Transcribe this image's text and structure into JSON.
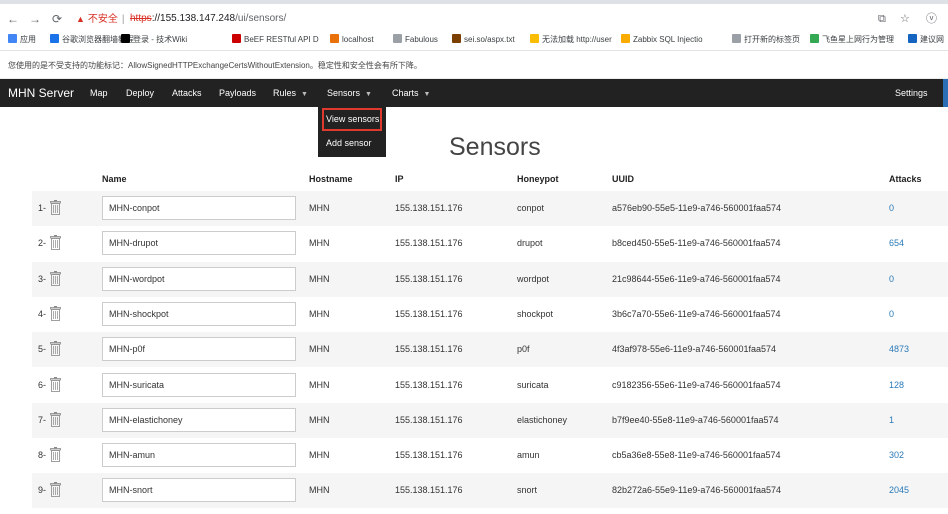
{
  "browser": {
    "security_label": "不安全",
    "url_protocol": "https",
    "url_host": "://155.138.147.248",
    "url_path": "/ui/sensors/",
    "bookmarks": [
      {
        "label": "应用",
        "color": "#4285f4"
      },
      {
        "label": "谷歌浏览器翻墙教程",
        "color": "#1a73e8"
      },
      {
        "label": "登录 - 技术Wiki",
        "color": "#000000"
      },
      {
        "label": "BeEF RESTful API D",
        "color": "#cc0000"
      },
      {
        "label": "localhost",
        "color": "#e8710a"
      },
      {
        "label": "Fabulous",
        "color": "#9aa0a6"
      },
      {
        "label": "sei.so/aspx.txt",
        "color": "#7b3f00"
      },
      {
        "label": "无法加载 http://user",
        "color": "#fbbc04"
      },
      {
        "label": "Zabbix SQL Injectio",
        "color": "#f9ab00"
      },
      {
        "label": "打开新的标签页",
        "color": "#9aa0a6"
      },
      {
        "label": "飞鱼星上网行为管理",
        "color": "#34a853"
      },
      {
        "label": "建议网",
        "color": "#1565c0"
      }
    ],
    "info_message": "您使用的是不受支持的功能标记：AllowSignedHTTPExchangeCertsWithoutExtension。稳定性和安全性会有所下降。"
  },
  "navbar": {
    "brand": "MHN Server",
    "items": [
      {
        "label": "Map",
        "dropdown": false
      },
      {
        "label": "Deploy",
        "dropdown": false
      },
      {
        "label": "Attacks",
        "dropdown": false
      },
      {
        "label": "Payloads",
        "dropdown": false
      },
      {
        "label": "Rules",
        "dropdown": true
      },
      {
        "label": "Sensors",
        "dropdown": true
      },
      {
        "label": "Charts",
        "dropdown": true
      }
    ],
    "settings": "Settings"
  },
  "sensors_menu": {
    "view": "View sensors",
    "add": "Add sensor"
  },
  "page_title": "Sensors",
  "table": {
    "headers": [
      "Name",
      "Hostname",
      "IP",
      "Honeypot",
      "UUID",
      "Attacks"
    ],
    "rows": [
      {
        "idx": "1-",
        "name": "MHN-conpot",
        "hostname": "MHN",
        "ip": "155.138.151.176",
        "honeypot": "conpot",
        "uuid": "a576eb90-55e5-11e9-a746-560001faa574",
        "attacks": "0"
      },
      {
        "idx": "2-",
        "name": "MHN-drupot",
        "hostname": "MHN",
        "ip": "155.138.151.176",
        "honeypot": "drupot",
        "uuid": "b8ced450-55e5-11e9-a746-560001faa574",
        "attacks": "654"
      },
      {
        "idx": "3-",
        "name": "MHN-wordpot",
        "hostname": "MHN",
        "ip": "155.138.151.176",
        "honeypot": "wordpot",
        "uuid": "21c98644-55e6-11e9-a746-560001faa574",
        "attacks": "0"
      },
      {
        "idx": "4-",
        "name": "MHN-shockpot",
        "hostname": "MHN",
        "ip": "155.138.151.176",
        "honeypot": "shockpot",
        "uuid": "3b6c7a70-55e6-11e9-a746-560001faa574",
        "attacks": "0"
      },
      {
        "idx": "5-",
        "name": "MHN-p0f",
        "hostname": "MHN",
        "ip": "155.138.151.176",
        "honeypot": "p0f",
        "uuid": "4f3af978-55e6-11e9-a746-560001faa574",
        "attacks": "4873"
      },
      {
        "idx": "6-",
        "name": "MHN-suricata",
        "hostname": "MHN",
        "ip": "155.138.151.176",
        "honeypot": "suricata",
        "uuid": "c9182356-55e6-11e9-a746-560001faa574",
        "attacks": "128"
      },
      {
        "idx": "7-",
        "name": "MHN-elastichoney",
        "hostname": "MHN",
        "ip": "155.138.151.176",
        "honeypot": "elastichoney",
        "uuid": "b7f9ee40-55e8-11e9-a746-560001faa574",
        "attacks": "1"
      },
      {
        "idx": "8-",
        "name": "MHN-amun",
        "hostname": "MHN",
        "ip": "155.138.151.176",
        "honeypot": "amun",
        "uuid": "cb5a36e8-55e8-11e9-a746-560001faa574",
        "attacks": "302"
      },
      {
        "idx": "9-",
        "name": "MHN-snort",
        "hostname": "MHN",
        "ip": "155.138.151.176",
        "honeypot": "snort",
        "uuid": "82b272a6-55e9-11e9-a746-560001faa574",
        "attacks": "2045"
      }
    ]
  }
}
